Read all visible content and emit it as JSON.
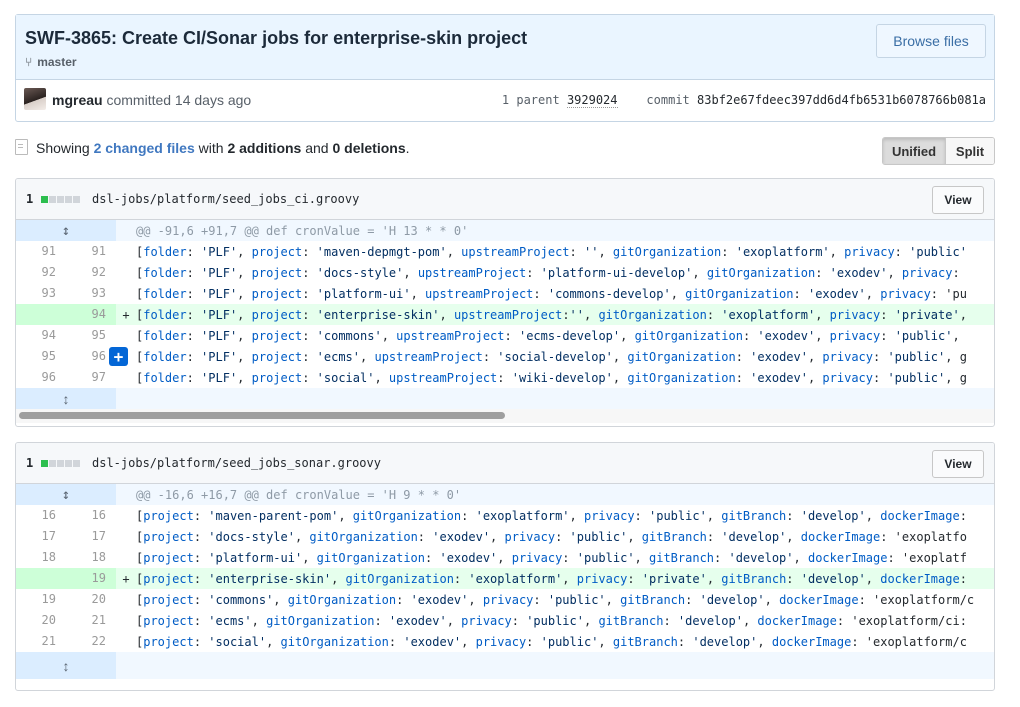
{
  "commit": {
    "title": "SWF-3865: Create CI/Sonar jobs for enterprise-skin project",
    "branch": "master",
    "browse_label": "Browse files",
    "author": "mgreau",
    "action": "committed 14 days ago",
    "parent_label": "1 parent",
    "parent_sha": "3929024",
    "commit_label": "commit",
    "commit_sha": "83bf2e67fdeec397dd6d4fb6531b6078766b081a"
  },
  "summary": {
    "showing": "Showing",
    "changed_files": "2 changed files",
    "with": "with",
    "additions": "2 additions",
    "and": "and",
    "deletions": "0 deletions",
    "period": "."
  },
  "view_toggle": {
    "unified": "Unified",
    "split": "Split",
    "selected": "Unified"
  },
  "colors": {
    "addition": "#e6ffed",
    "hunk": "#f1f8ff",
    "link": "#4078c0"
  },
  "files": [
    {
      "count": "1",
      "path": "dsl-jobs/platform/seed_jobs_ci.groovy",
      "view_label": "View",
      "hunk": "@@ -91,6 +91,7 @@ def cronValue = 'H 13 * * 0'",
      "lines": [
        {
          "old": "91",
          "new": "91",
          "sign": "",
          "type": "ctx",
          "code": "[folder: 'PLF', project: 'maven-depmgt-pom', upstreamProject: '', gitOrganization: 'exoplatform', privacy: 'public'"
        },
        {
          "old": "92",
          "new": "92",
          "sign": "",
          "type": "ctx",
          "code": "[folder: 'PLF', project: 'docs-style', upstreamProject: 'platform-ui-develop', gitOrganization: 'exodev', privacy:"
        },
        {
          "old": "93",
          "new": "93",
          "sign": "",
          "type": "ctx",
          "code": "[folder: 'PLF', project: 'platform-ui', upstreamProject: 'commons-develop', gitOrganization: 'exodev', privacy: 'pu"
        },
        {
          "old": "",
          "new": "94",
          "sign": "+",
          "type": "add",
          "code": "[folder: 'PLF', project: 'enterprise-skin', upstreamProject:'', gitOrganization: 'exoplatform', privacy: 'private',"
        },
        {
          "old": "94",
          "new": "95",
          "sign": "",
          "type": "ctx",
          "code": "[folder: 'PLF', project: 'commons', upstreamProject: 'ecms-develop', gitOrganization: 'exodev', privacy: 'public',"
        },
        {
          "old": "95",
          "new": "96",
          "sign": "",
          "type": "ctx",
          "code": "[folder: 'PLF', project: 'ecms', upstreamProject: 'social-develop', gitOrganization: 'exodev', privacy: 'public', g"
        },
        {
          "old": "96",
          "new": "97",
          "sign": "",
          "type": "ctx",
          "code": "[folder: 'PLF', project: 'social', upstreamProject: 'wiki-develop', gitOrganization: 'exodev', privacy: 'public', g"
        }
      ]
    },
    {
      "count": "1",
      "path": "dsl-jobs/platform/seed_jobs_sonar.groovy",
      "view_label": "View",
      "hunk": "@@ -16,6 +16,7 @@ def cronValue = 'H 9 * * 0'",
      "lines": [
        {
          "old": "16",
          "new": "16",
          "sign": "",
          "type": "ctx",
          "code": "[project: 'maven-parent-pom', gitOrganization: 'exoplatform', privacy: 'public', gitBranch: 'develop', dockerImage:"
        },
        {
          "old": "17",
          "new": "17",
          "sign": "",
          "type": "ctx",
          "code": "[project: 'docs-style', gitOrganization: 'exodev', privacy: 'public', gitBranch: 'develop', dockerImage: 'exoplatfo"
        },
        {
          "old": "18",
          "new": "18",
          "sign": "",
          "type": "ctx",
          "code": "[project: 'platform-ui', gitOrganization: 'exodev', privacy: 'public', gitBranch: 'develop', dockerImage: 'exoplatf"
        },
        {
          "old": "",
          "new": "19",
          "sign": "+",
          "type": "add",
          "code": "[project: 'enterprise-skin', gitOrganization: 'exoplatform', privacy: 'private', gitBranch: 'develop', dockerImage:"
        },
        {
          "old": "19",
          "new": "20",
          "sign": "",
          "type": "ctx",
          "code": "[project: 'commons', gitOrganization: 'exodev', privacy: 'public', gitBranch: 'develop', dockerImage: 'exoplatform/c"
        },
        {
          "old": "20",
          "new": "21",
          "sign": "",
          "type": "ctx",
          "code": "[project: 'ecms', gitOrganization: 'exodev', privacy: 'public', gitBranch: 'develop', dockerImage: 'exoplatform/ci:"
        },
        {
          "old": "21",
          "new": "22",
          "sign": "",
          "type": "ctx",
          "code": "[project: 'social', gitOrganization: 'exodev', privacy: 'public', gitBranch: 'develop', dockerImage: 'exoplatform/c"
        }
      ]
    }
  ]
}
